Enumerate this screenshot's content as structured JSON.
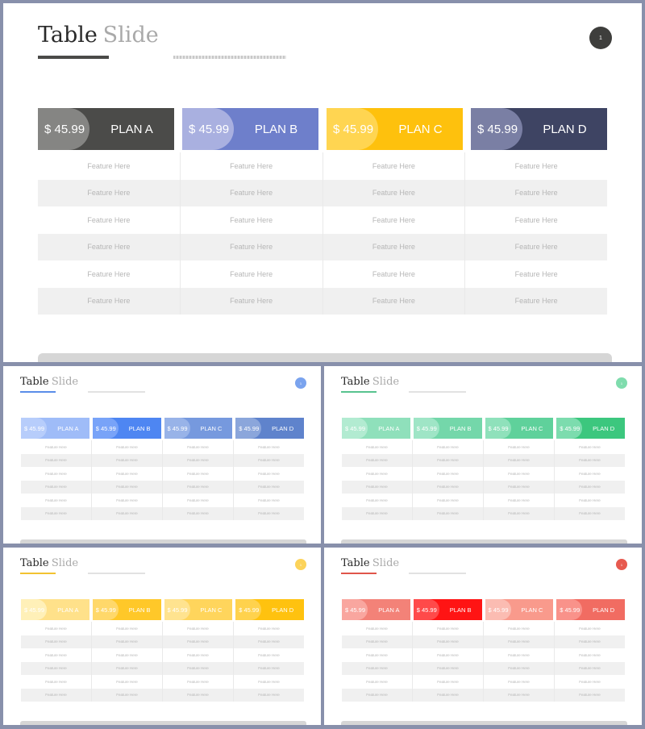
{
  "title_primary": "Table",
  "title_secondary": "Slide",
  "page_number": "1",
  "price": "$ 45.99",
  "plans": [
    "PLAN A",
    "PLAN B",
    "PLAN C",
    "PLAN D"
  ],
  "feature_text": "Feature Here",
  "feature_row_count": 6,
  "slides": [
    {
      "theme": "dark",
      "accent": "#4a4a48",
      "badge": "#3e3e3c",
      "headers": [
        {
          "tab": "#858583",
          "body": "#4b4b49"
        },
        {
          "tab": "#a9b0e0",
          "body": "#6e7fcb"
        },
        {
          "tab": "#ffd551",
          "body": "#fec10d"
        },
        {
          "tab": "#7a7fa4",
          "body": "#3e4463"
        }
      ]
    },
    {
      "theme": "blue",
      "accent": "#5a8de8",
      "badge": "#7aa3ee",
      "headers": [
        {
          "tab": "#b7cdfb",
          "body": "#9fbcf8"
        },
        {
          "tab": "#78a3f8",
          "body": "#4e86f2"
        },
        {
          "tab": "#98b3e8",
          "body": "#7699de"
        },
        {
          "tab": "#8ba6db",
          "body": "#5f83cc"
        }
      ]
    },
    {
      "theme": "green",
      "accent": "#58c38f",
      "badge": "#7fdcad",
      "headers": [
        {
          "tab": "#b2ebd1",
          "body": "#8fe0bb"
        },
        {
          "tab": "#9fe5c6",
          "body": "#74d7aa"
        },
        {
          "tab": "#8fe1bb",
          "body": "#5fd19b"
        },
        {
          "tab": "#7cdcae",
          "body": "#3cc77e"
        }
      ]
    },
    {
      "theme": "yellow",
      "accent": "#f2c230",
      "badge": "#fcd35a",
      "headers": [
        {
          "tab": "#fff0b8",
          "body": "#ffe18a"
        },
        {
          "tab": "#ffd86a",
          "body": "#ffc829"
        },
        {
          "tab": "#ffe38f",
          "body": "#ffd55c"
        },
        {
          "tab": "#ffd24d",
          "body": "#ffc20f"
        }
      ]
    },
    {
      "theme": "red",
      "accent": "#e0554a",
      "badge": "#e75a4f",
      "headers": [
        {
          "tab": "#f9a69f",
          "body": "#f38278"
        },
        {
          "tab": "#ff4a4a",
          "body": "#ff1414"
        },
        {
          "tab": "#fbbcb2",
          "body": "#f99a8c"
        },
        {
          "tab": "#f9928a",
          "body": "#f16c62"
        }
      ]
    }
  ]
}
